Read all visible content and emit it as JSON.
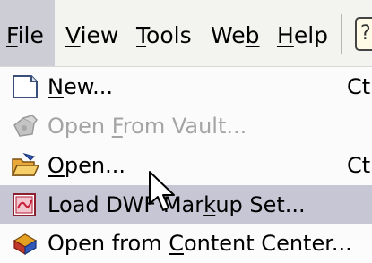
{
  "menubar": {
    "items": [
      {
        "pre": "",
        "acc": "F",
        "post": "ile",
        "active": true
      },
      {
        "pre": "",
        "acc": "V",
        "post": "iew",
        "active": false
      },
      {
        "pre": "",
        "acc": "T",
        "post": "ools",
        "active": false
      },
      {
        "pre": "We",
        "acc": "b",
        "post": "",
        "active": false
      },
      {
        "pre": "",
        "acc": "H",
        "post": "elp",
        "active": false
      }
    ],
    "toolbar_glyph": "?"
  },
  "file_menu": {
    "items": [
      {
        "pre": "",
        "acc": "N",
        "post": "ew...",
        "shortcut": "Ct",
        "icon": "new-document-icon",
        "enabled": true,
        "highlighted": false
      },
      {
        "pre": "Open ",
        "acc": "F",
        "post": "rom Vault...",
        "shortcut": "",
        "icon": "vault-icon",
        "enabled": false,
        "highlighted": false
      },
      {
        "pre": "",
        "acc": "O",
        "post": "pen...",
        "shortcut": "Ct",
        "icon": "open-folder-icon",
        "enabled": true,
        "highlighted": false
      },
      {
        "pre": "Load DWF Mar",
        "acc": "k",
        "post": "up Set...",
        "shortcut": "",
        "icon": "dwf-markup-icon",
        "enabled": true,
        "highlighted": true
      },
      {
        "pre": "Open from ",
        "acc": "C",
        "post": "ontent Center...",
        "shortcut": "",
        "icon": "content-center-icon",
        "enabled": true,
        "highlighted": false
      }
    ]
  },
  "colors": {
    "menubar_bg": "#f3f3f0",
    "active_bg": "#cdcdd6",
    "highlight_bg": "#c6c6d4",
    "disabled_text": "#a4a4a4"
  }
}
